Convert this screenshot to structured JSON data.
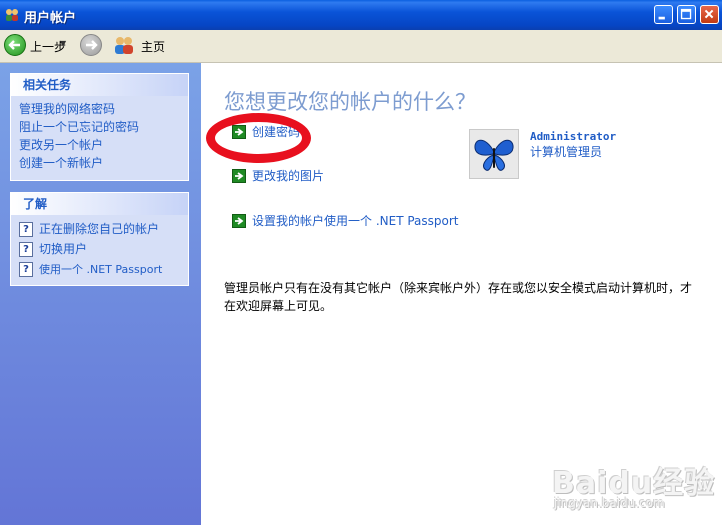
{
  "window": {
    "title": "用户帐户"
  },
  "toolbar": {
    "back_label": "上一步",
    "home_label": "主页"
  },
  "sidebar": {
    "tasks_header": "相关任务",
    "tasks": [
      "管理我的网络密码",
      "阻止一个已忘记的密码",
      "更改另一个帐户",
      "创建一个新帐户"
    ],
    "learn_header": "了解",
    "learn": [
      "正在删除您自己的帐户",
      "切换用户",
      "使用一个 .NET Passport"
    ]
  },
  "main": {
    "heading": "您想更改您的帐户的什么？",
    "options": [
      "创建密码",
      "更改我的图片",
      "设置我的帐户使用一个 .NET Passport"
    ],
    "account_name": "Administrator",
    "account_role": "计算机管理员",
    "note": "管理员帐户只有在没有其它帐户（除来宾帐户外）存在或您以安全模式启动计算机时，才在欢迎屏幕上可见。"
  },
  "watermark": {
    "brand": "Baidu经验",
    "url": "jingyan.baidu.com"
  },
  "colors": {
    "link": "#215dc6",
    "heading": "#7d9cd0",
    "sidebar": "#6f8de0",
    "highlight": "#e8101e"
  },
  "icons": [
    "user-accounts-icon",
    "back-icon",
    "forward-icon",
    "home-icon",
    "help-icon",
    "green-arrow-icon",
    "butterfly-avatar"
  ]
}
